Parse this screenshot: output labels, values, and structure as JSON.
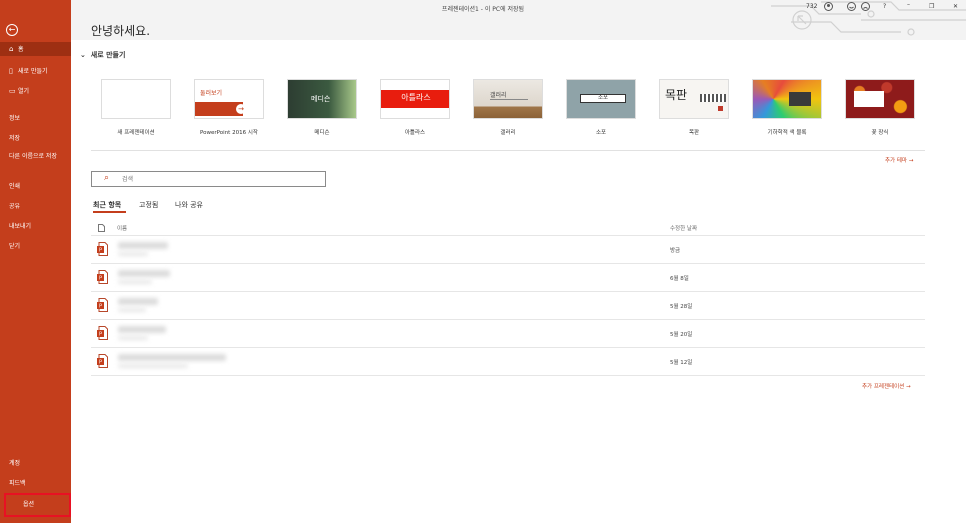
{
  "window": {
    "title": "프레젠테이션1 - 이 PC에 저장됨",
    "badge": "732",
    "help": "?"
  },
  "sidebar": {
    "items": [
      {
        "label": "홈",
        "icon": "home-icon"
      },
      {
        "label": "새로 만들기",
        "icon": "new-document-icon"
      },
      {
        "label": "열기",
        "icon": "folder-open-icon"
      },
      {
        "label": "정보"
      },
      {
        "label": "저장"
      },
      {
        "label": "다른 이름으로 저장"
      },
      {
        "label": "인쇄"
      },
      {
        "label": "공유"
      },
      {
        "label": "내보내기"
      },
      {
        "label": "닫기"
      }
    ],
    "bottom": [
      {
        "label": "계정"
      },
      {
        "label": "피드백"
      },
      {
        "label": "옵션"
      }
    ]
  },
  "greeting": "안녕하세요.",
  "new_section": {
    "title": "새로 만들기",
    "templates": [
      {
        "label": "새 프레젠테이션"
      },
      {
        "label": "PowerPoint 2016 시작",
        "thumb_text": "둘러보기"
      },
      {
        "label": "메디슨",
        "thumb_text": "메디슨"
      },
      {
        "label": "아틀라스",
        "thumb_text": "아틀라스"
      },
      {
        "label": "갤러리",
        "thumb_text": "갤러리"
      },
      {
        "label": "소포",
        "thumb_text": "소포"
      },
      {
        "label": "목판",
        "thumb_text": "목판"
      },
      {
        "label": "기하학적 색 블록",
        "thumb_text": ""
      },
      {
        "label": "꽃 장식",
        "thumb_text": ""
      }
    ],
    "more_themes": "추가 테마 →"
  },
  "search": {
    "placeholder": "검색"
  },
  "tabs": [
    "최근 항목",
    "고정됨",
    "나와 공유"
  ],
  "file_list": {
    "col_name": "이름",
    "col_date": "수정한 날짜",
    "rows": [
      {
        "date": "방금"
      },
      {
        "date": "6월 8일"
      },
      {
        "date": "5월 28일"
      },
      {
        "date": "5월 20일"
      },
      {
        "date": "5월 12일"
      }
    ],
    "more": "추가 프레젠테이션 →"
  },
  "colors": {
    "accent": "#c43e1c",
    "sidebar_active": "#9e2f12"
  }
}
